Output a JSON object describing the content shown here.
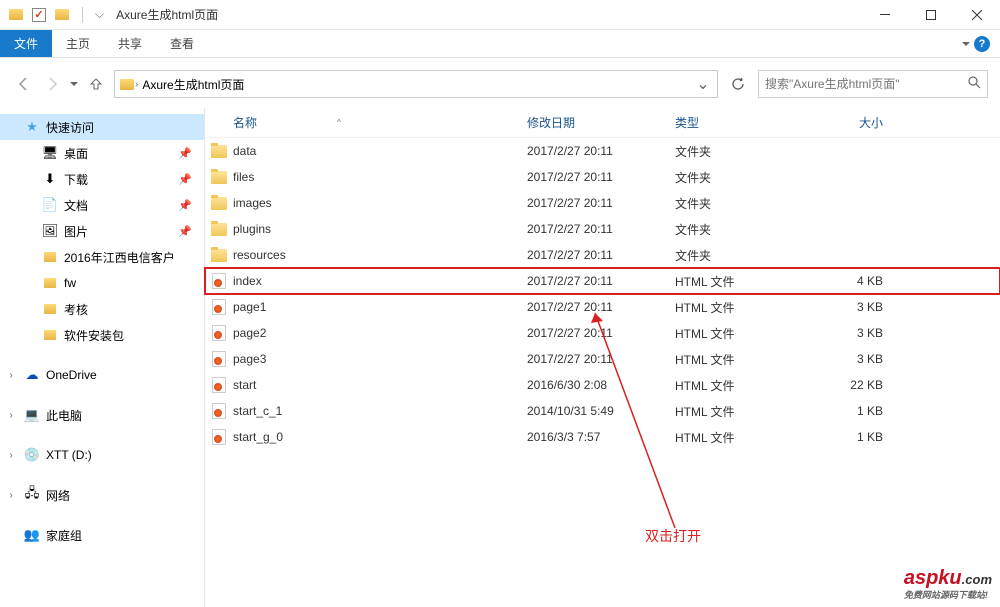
{
  "window": {
    "title": "Axure生成html页面"
  },
  "ribbon": {
    "file": "文件",
    "home": "主页",
    "share": "共享",
    "view": "查看"
  },
  "address": {
    "segment": "Axure生成html页面"
  },
  "search": {
    "placeholder": "搜索\"Axure生成html页面\""
  },
  "sidebar": {
    "quick_access": "快速访问",
    "desktop": "桌面",
    "downloads": "下载",
    "documents": "文档",
    "pictures": "图片",
    "custom1": "2016年江西电信客户",
    "custom2": "fw",
    "custom3": "考核",
    "custom4": "软件安装包",
    "onedrive": "OneDrive",
    "this_pc": "此电脑",
    "drive": "XTT (D:)",
    "network": "网络",
    "homegroup": "家庭组"
  },
  "columns": {
    "name": "名称",
    "date": "修改日期",
    "type": "类型",
    "size": "大小"
  },
  "types": {
    "folder": "文件夹",
    "html": "HTML 文件"
  },
  "files": [
    {
      "name": "data",
      "date": "2017/2/27 20:11",
      "type": "folder",
      "size": ""
    },
    {
      "name": "files",
      "date": "2017/2/27 20:11",
      "type": "folder",
      "size": ""
    },
    {
      "name": "images",
      "date": "2017/2/27 20:11",
      "type": "folder",
      "size": ""
    },
    {
      "name": "plugins",
      "date": "2017/2/27 20:11",
      "type": "folder",
      "size": ""
    },
    {
      "name": "resources",
      "date": "2017/2/27 20:11",
      "type": "folder",
      "size": ""
    },
    {
      "name": "index",
      "date": "2017/2/27 20:11",
      "type": "html",
      "size": "4 KB",
      "highlighted": true
    },
    {
      "name": "page1",
      "date": "2017/2/27 20:11",
      "type": "html",
      "size": "3 KB"
    },
    {
      "name": "page2",
      "date": "2017/2/27 20:11",
      "type": "html",
      "size": "3 KB"
    },
    {
      "name": "page3",
      "date": "2017/2/27 20:11",
      "type": "html",
      "size": "3 KB"
    },
    {
      "name": "start",
      "date": "2016/6/30 2:08",
      "type": "html",
      "size": "22 KB"
    },
    {
      "name": "start_c_1",
      "date": "2014/10/31 5:49",
      "type": "html",
      "size": "1 KB"
    },
    {
      "name": "start_g_0",
      "date": "2016/3/3 7:57",
      "type": "html",
      "size": "1 KB"
    }
  ],
  "annotation": {
    "text": "双击打开"
  },
  "watermark": {
    "main": "aspku",
    "domain": ".com",
    "sub": "免费网站源码下载站!"
  }
}
